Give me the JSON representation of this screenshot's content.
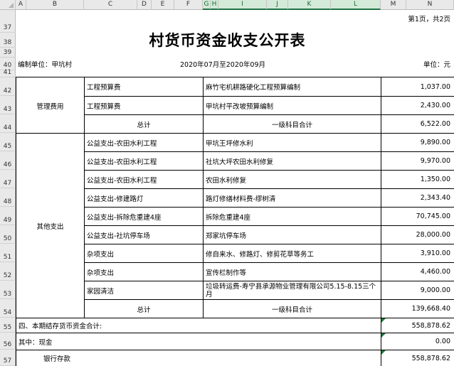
{
  "columns": [
    "A",
    "B",
    "C",
    "D",
    "E",
    "F",
    "G",
    "H",
    "I",
    "J",
    "K",
    "L",
    "M",
    "N"
  ],
  "rows": [
    "37",
    "38",
    "39",
    "40",
    "41",
    "42",
    "43",
    "44",
    "45",
    "46",
    "47",
    "48",
    "49",
    "50",
    "51",
    "52",
    "53",
    "54",
    "55",
    "56",
    "57"
  ],
  "page_info": "第1页，共2页",
  "title": "村货币资金收支公开表",
  "unit_label": "编制单位：甲坑村",
  "period": "2020年07月至2020年09月",
  "currency_unit": "单位：元",
  "groups": {
    "admin": "管理费用",
    "other": "其他支出"
  },
  "admin_rows": [
    {
      "item": "工程预算费",
      "desc": "麻竹宅机耕路硬化工程预算编制",
      "amount": "1,037.00"
    },
    {
      "item": "工程预算费",
      "desc": "甲坑村平改坡预算编制",
      "amount": "2,430.00"
    }
  ],
  "admin_total": {
    "label": "总计",
    "desc": "一级科目合计",
    "amount": "6,522.00"
  },
  "other_rows": [
    {
      "item": "公益支出-农田水利工程",
      "desc": "甲坑王坪修水利",
      "amount": "9,890.00"
    },
    {
      "item": "公益支出-农田水利工程",
      "desc": "社坑大坪农田水利修复",
      "amount": "9,970.00"
    },
    {
      "item": "公益支出-农田水利工程",
      "desc": "农田水利修复",
      "amount": "1,350.00"
    },
    {
      "item": "公益支出-修建路灯",
      "desc": "路灯修缮材料费-缪树清",
      "amount": "2,343.40"
    },
    {
      "item": "公益支出-拆除危重建4座",
      "desc": "拆除危重建4座",
      "amount": "70,745.00"
    },
    {
      "item": "公益支出-社坑停车场",
      "desc": "郑家坑停车场",
      "amount": "28,000.00"
    },
    {
      "item": "杂项支出",
      "desc": "修自来水、修路灯、修剪花草等务工",
      "amount": "3,910.00"
    },
    {
      "item": "杂项支出",
      "desc": "宣传栏制作等",
      "amount": "4,460.00"
    },
    {
      "item": "家园清洁",
      "desc": "垃圾转运费-寿宁县承源物业管理有限公司5.15-8.15三个月",
      "amount": "9,000.00"
    }
  ],
  "other_total": {
    "label": "总计",
    "desc": "一级科目合计",
    "amount": "139,668.40"
  },
  "balance_label": "四、本期结存货币资金合计:",
  "balance_amount": "558,878.62",
  "cash_label": "其中：现金",
  "cash_amount": "0.00",
  "bank_label": "银行存款",
  "bank_amount": "558,878.62"
}
